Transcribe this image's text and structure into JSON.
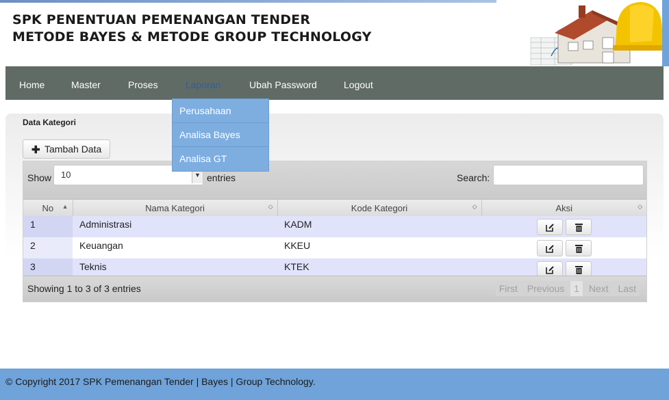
{
  "header": {
    "title_line1": "SPK PENENTUAN PEMENANGAN TENDER",
    "title_line2": "METODE BAYES & METODE GROUP TECHNOLOGY",
    "logo_icon": "construction-house-hardhat-logo"
  },
  "nav": {
    "items": [
      {
        "label": "Home"
      },
      {
        "label": "Master"
      },
      {
        "label": "Proses"
      },
      {
        "label": "Laporan",
        "active": true
      },
      {
        "label": "Ubah Password"
      },
      {
        "label": "Logout"
      }
    ],
    "dropdown": [
      {
        "label": "Perusahaan"
      },
      {
        "label": "Analisa Bayes"
      },
      {
        "label": "Analisa GT"
      }
    ]
  },
  "panel": {
    "title": "Data Kategori",
    "add_button": "Tambah Data"
  },
  "table": {
    "show_label": "Show",
    "page_length": "10",
    "entries_label": "entries",
    "search_label": "Search:",
    "search_value": "",
    "columns": [
      "No",
      "Nama Kategori",
      "Kode Kategori",
      "Aksi"
    ],
    "rows": [
      {
        "no": "1",
        "nama": "Administrasi",
        "kode": "KADM"
      },
      {
        "no": "2",
        "nama": "Keuangan",
        "kode": "KKEU"
      },
      {
        "no": "3",
        "nama": "Teknis",
        "kode": "KTEK"
      }
    ],
    "info": "Showing 1 to 3 of 3 entries",
    "pager": {
      "first": "First",
      "previous": "Previous",
      "page": "1",
      "next": "Next",
      "last": "Last"
    }
  },
  "footer": {
    "text": "© Copyright 2017 SPK Pemenangan Tender | Bayes | Group Technology."
  },
  "colors": {
    "navbar": "#606b65",
    "footer": "#6fa3da",
    "dropdown": "#7eaee0",
    "row_odd": "#e1e3fb"
  }
}
